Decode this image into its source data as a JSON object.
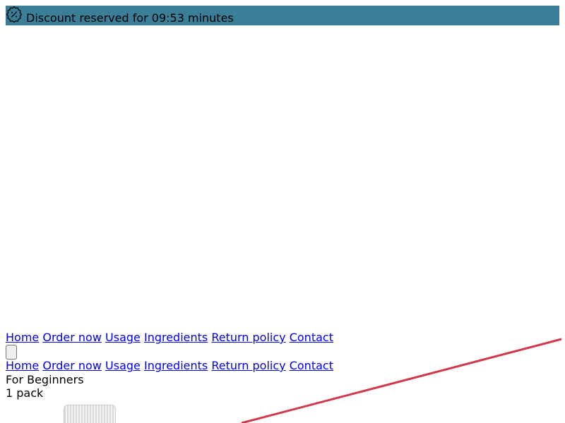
{
  "promo": {
    "icon": "discount-badge-icon",
    "text": "Discount reserved for 09:53 minutes",
    "background_color": "#3a7e98"
  },
  "nav": {
    "primary": [
      "Home",
      "Order now",
      "Usage",
      "Ingredients",
      "Return policy",
      "Contact"
    ],
    "secondary": [
      "Home",
      "Order now",
      "Usage",
      "Ingredients",
      "Return policy",
      "Contact"
    ]
  },
  "menu_toggle": {
    "label": ""
  },
  "product": {
    "plan_name": "For Beginners",
    "quantity": "1 pack",
    "image_icon": "product-bottle-cap"
  },
  "colors": {
    "link": "#0000ee",
    "accent_line": "#d4364a"
  }
}
